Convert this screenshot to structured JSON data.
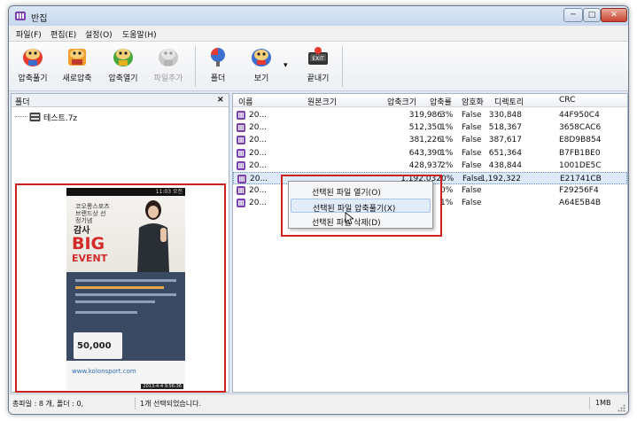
{
  "window": {
    "title": "반집",
    "minimize": "─",
    "maximize": "□",
    "close": "✕"
  },
  "menu": [
    "파일(F)",
    "편집(E)",
    "설정(O)",
    "도움말(H)"
  ],
  "toolbar": {
    "buttons": [
      {
        "label": "압축풀기",
        "icon": "extract-icon"
      },
      {
        "label": "새로압축",
        "icon": "new-archive-icon"
      },
      {
        "label": "압축열기",
        "icon": "open-archive-icon"
      },
      {
        "label": "파일추가",
        "icon": "add-file-icon",
        "disabled": true
      },
      {
        "label": "폴더",
        "icon": "folder-view-icon"
      },
      {
        "label": "보기",
        "icon": "view-icon"
      },
      {
        "label": "끝내기",
        "icon": "exit-icon"
      }
    ],
    "dropdown_arrow": "▾"
  },
  "folder_pane": {
    "title": "폴더",
    "close": "×",
    "tree_item": "테스트.7z"
  },
  "preview": {
    "status": "11:03 오전",
    "brand": "코오롱스포츠 브랜드상 선정기념",
    "thanks": "감사",
    "big": "BIG",
    "event": "EVENT",
    "coupon": "50,000",
    "url": "www.kolonsport.com",
    "stamp": "2013-4-4 9:56:36"
  },
  "list": {
    "columns": [
      "이름",
      "원본크기",
      "압축크기",
      "압축률",
      "암호화",
      "디렉토리",
      "CRC"
    ],
    "rows": [
      {
        "name": "20...",
        "size": "330,848",
        "packed": "319,986",
        "ratio": "3%",
        "encrypted": "False",
        "dir": "",
        "crc": "44F950C4"
      },
      {
        "name": "20...",
        "size": "518,367",
        "packed": "512,350",
        "ratio": "1%",
        "encrypted": "False",
        "dir": "",
        "crc": "3658CAC6"
      },
      {
        "name": "20...",
        "size": "387,617",
        "packed": "381,226",
        "ratio": "1%",
        "encrypted": "False",
        "dir": "",
        "crc": "E8D9B854"
      },
      {
        "name": "20...",
        "size": "651,364",
        "packed": "643,390",
        "ratio": "1%",
        "encrypted": "False",
        "dir": "",
        "crc": "B7FB1BE0"
      },
      {
        "name": "20...",
        "size": "438,844",
        "packed": "428,937",
        "ratio": "2%",
        "encrypted": "False",
        "dir": "",
        "crc": "1001DE5C"
      },
      {
        "name": "20...",
        "size": "1,192,322",
        "packed": "1,192,032",
        "ratio": "0%",
        "encrypted": "False",
        "dir": "",
        "crc": "E21741CB",
        "selected": true
      },
      {
        "name": "20...",
        "size": "",
        "packed": "",
        "ratio": "0%",
        "encrypted": "False",
        "dir": "",
        "crc": "F29256F4"
      },
      {
        "name": "20...",
        "size": "",
        "packed": "",
        "ratio": "1%",
        "encrypted": "False",
        "dir": "",
        "crc": "A64E5B4B"
      }
    ]
  },
  "context_menu": {
    "items": [
      {
        "label": "선택된 파일 열기(O)"
      },
      {
        "label": "선택된 파일 압축풀기(X)",
        "hover": true
      },
      {
        "label": "선택된 파일 삭제(D)"
      }
    ]
  },
  "status": {
    "counts": "총파일 : 8 개, 폴더 : 0,",
    "selection": "1개 선택되었습니다.",
    "size": "1MB"
  },
  "colors": {
    "highlight_outline": "#cf1f1f",
    "selection": "#dbe9f9",
    "titlebar": "#c7d8ee"
  }
}
